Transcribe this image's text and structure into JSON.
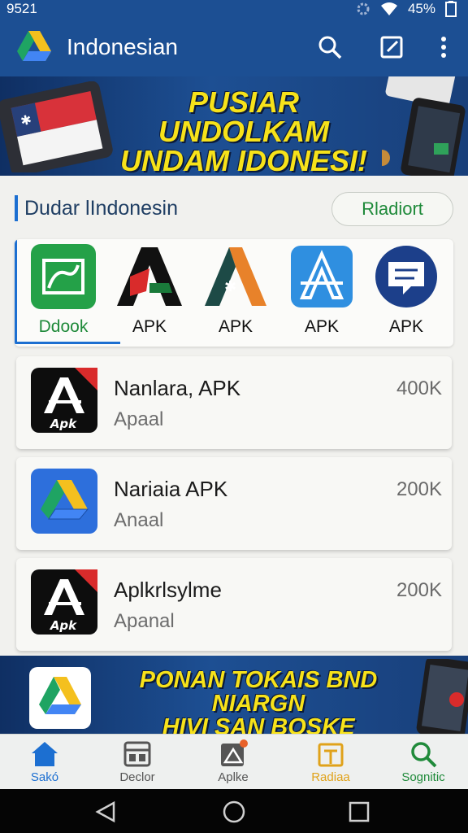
{
  "status": {
    "time": "9521",
    "battery": "45%"
  },
  "appbar": {
    "title": "Indonesian"
  },
  "banner_top": {
    "line1": "PUSIAR UNDOLKAM",
    "line2": "UNDAM IDONESI!"
  },
  "section": {
    "title": "Dudar lIndonesin",
    "pill_label": "Rladiort"
  },
  "carousel": [
    {
      "label": "Ddook",
      "icon": "map-app-icon"
    },
    {
      "label": "APK",
      "icon": "apk-a-red-icon"
    },
    {
      "label": "APK",
      "icon": "apk-a-orange-icon"
    },
    {
      "label": "APK",
      "icon": "app-store-icon"
    },
    {
      "label": "APK",
      "icon": "chat-bubble-icon"
    }
  ],
  "list": [
    {
      "name": "Nanlara, APK",
      "sub": "Apaal",
      "count": "400K",
      "icon": "apk-logo-icon"
    },
    {
      "name": "Nariaia APK",
      "sub": "Anaal",
      "count": "200K",
      "icon": "drive-logo-icon"
    },
    {
      "name": "Aplkrlsylme",
      "sub": "Apanal",
      "count": "200K",
      "icon": "apk-logo-icon"
    }
  ],
  "banner_bottom": {
    "line1": "PONAN TOKAIS BND NIARGN",
    "line2": "HIVI SAN BOSKE TIOKEONESIN!"
  },
  "apk_badge": "Apk",
  "nav": [
    {
      "label": "Sakó",
      "icon": "home-icon",
      "color": "#1c6fd1"
    },
    {
      "label": "Declor",
      "icon": "dashboard-icon",
      "color": "#555555"
    },
    {
      "label": "Aplke",
      "icon": "apk-box-icon",
      "color": "#555555"
    },
    {
      "label": "Radiaa",
      "icon": "gift-icon",
      "color": "#e0a21a"
    },
    {
      "label": "Sognitic",
      "icon": "search-icon",
      "color": "#1f8a3a"
    }
  ],
  "colors": {
    "primary": "#1c4f93",
    "accent_blue": "#1c6fd1",
    "green": "#1f8a3a",
    "banner_text": "#f7e21a"
  }
}
